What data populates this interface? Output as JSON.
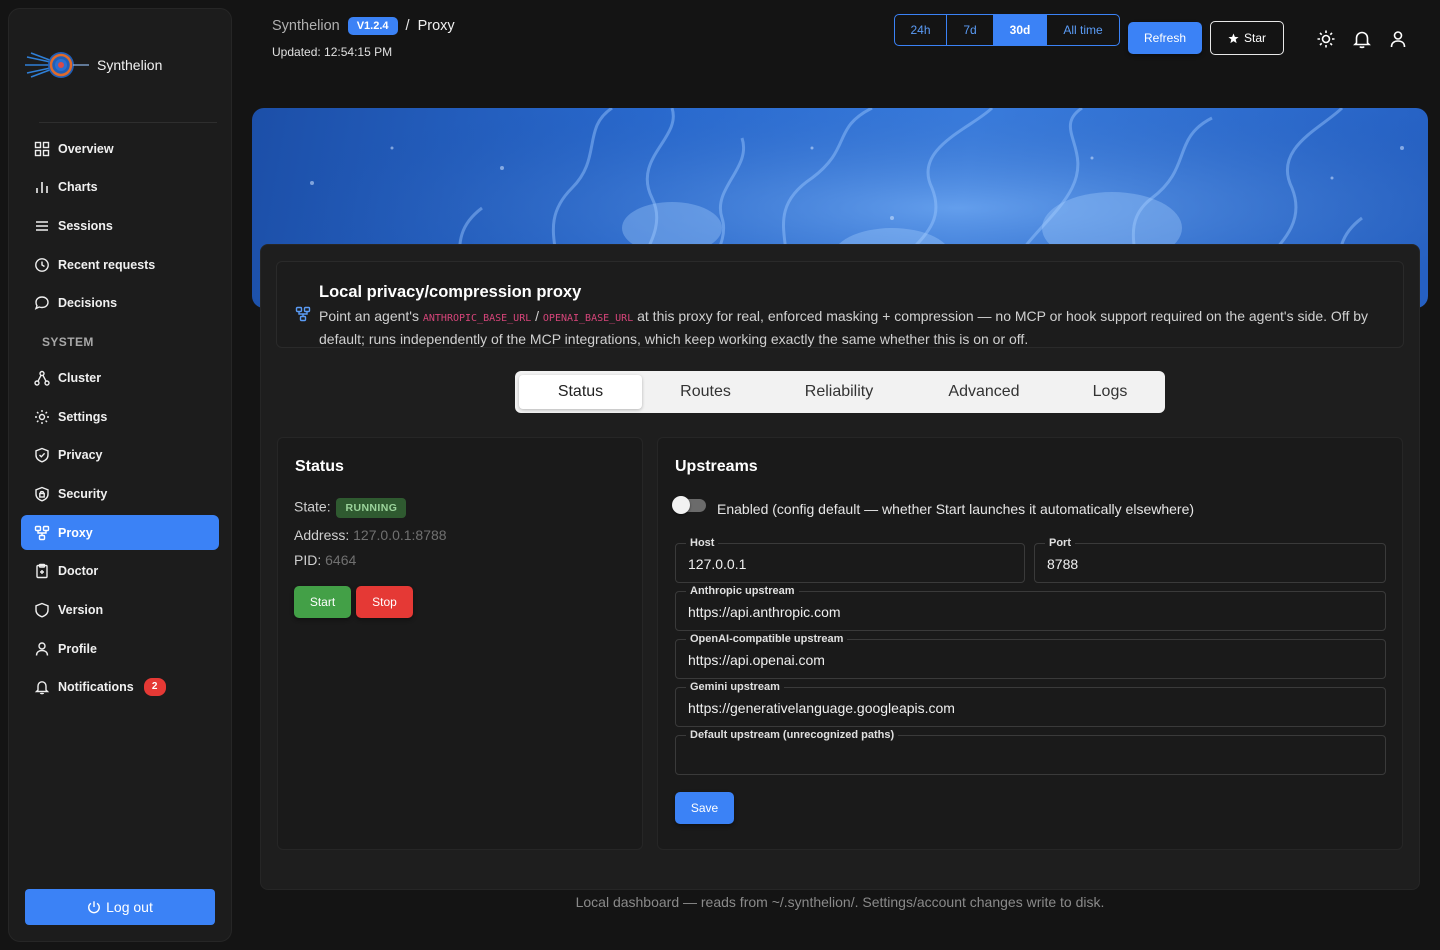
{
  "sidebar": {
    "brand": "Synthelion",
    "items": [
      {
        "label": "Overview",
        "icon": "grid-icon"
      },
      {
        "label": "Charts",
        "icon": "bar-chart-icon"
      },
      {
        "label": "Sessions",
        "icon": "list-icon"
      },
      {
        "label": "Recent requests",
        "icon": "clock-icon"
      },
      {
        "label": "Decisions",
        "icon": "chat-bubble-icon"
      }
    ],
    "section_label": "SYSTEM",
    "system_items": [
      {
        "label": "Cluster",
        "icon": "cluster-icon"
      },
      {
        "label": "Settings",
        "icon": "gear-icon"
      },
      {
        "label": "Privacy",
        "icon": "shield-check-icon"
      },
      {
        "label": "Security",
        "icon": "shield-lock-icon"
      },
      {
        "label": "Proxy",
        "icon": "proxy-icon",
        "active": true
      },
      {
        "label": "Doctor",
        "icon": "clipboard-icon"
      },
      {
        "label": "Version",
        "icon": "shield-icon"
      },
      {
        "label": "Profile",
        "icon": "user-icon"
      },
      {
        "label": "Notifications",
        "icon": "bell-icon",
        "count": "2"
      }
    ],
    "logout_label": "Log out"
  },
  "header": {
    "app": "Synthelion",
    "version": "V1.2.4",
    "separator": "/",
    "page": "Proxy",
    "updated": "Updated: 12:54:15 PM",
    "ranges": [
      "24h",
      "7d",
      "30d",
      "All time"
    ],
    "active_range": "30d",
    "refresh_label": "Refresh",
    "star_label": "Star"
  },
  "intro": {
    "title": "Local privacy/compression proxy",
    "text_before": "Point an agent's ",
    "code1": "ANTHROPIC_BASE_URL",
    "text_mid": " / ",
    "code2": "OPENAI_BASE_URL",
    "text_after": " at this proxy for real, enforced masking + compression — no MCP or hook support required on the agent's side. Off by default; runs independently of the MCP integrations, which keep working exactly the same whether this is on or off."
  },
  "tabs": [
    "Status",
    "Routes",
    "Reliability",
    "Advanced",
    "Logs"
  ],
  "active_tab": "Status",
  "status_panel": {
    "title": "Status",
    "state_label": "State:",
    "state_value": "RUNNING",
    "address_label": "Address:",
    "address_value": "127.0.0.1:8788",
    "pid_label": "PID:",
    "pid_value": "6464",
    "start_label": "Start",
    "stop_label": "Stop"
  },
  "upstreams_panel": {
    "title": "Upstreams",
    "enabled_label": "Enabled (config default — whether Start launches it automatically elsewhere)",
    "enabled": false,
    "host_label": "Host",
    "host_value": "127.0.0.1",
    "port_label": "Port",
    "port_value": "8788",
    "anthropic_label": "Anthropic upstream",
    "anthropic_value": "https://api.anthropic.com",
    "openai_label": "OpenAI-compatible upstream",
    "openai_value": "https://api.openai.com",
    "gemini_label": "Gemini upstream",
    "gemini_value": "https://generativelanguage.googleapis.com",
    "default_label": "Default upstream (unrecognized paths)",
    "default_value": "",
    "save_label": "Save"
  },
  "footer": "Local dashboard — reads from ~/.synthelion/. Settings/account changes write to disk.",
  "colors": {
    "accent": "#3b82f6",
    "running": "#2f5a30",
    "start": "#43a047",
    "stop": "#e53935"
  }
}
